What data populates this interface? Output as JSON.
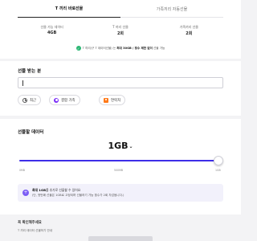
{
  "tabs": [
    {
      "label": "T 끼리 바로선물",
      "active": true
    },
    {
      "label": "가족끼리 자동선물",
      "active": false
    }
  ],
  "stats": [
    {
      "label": "선물 가능 데이터",
      "value": "4GB"
    },
    {
      "label": "T 끼리 선물",
      "value": "2회"
    },
    {
      "label": "가족끼리 선물",
      "value": "2회"
    }
  ],
  "info": {
    "icon": "check-icon",
    "prefix": "T 끼리(구 T 데이터선물) 는",
    "bold": "최대 30GB / 횟수 제한 없이",
    "suffix": "선물 가능"
  },
  "recipient": {
    "title": "선물 받는 분",
    "input_value": "",
    "chips": [
      {
        "label": "최근",
        "icon": "clock-icon"
      },
      {
        "label": "결합 가족",
        "icon": "family-icon"
      },
      {
        "label": "연락처",
        "icon": "contact-icon"
      }
    ]
  },
  "amount": {
    "title": "선물할 데이터",
    "value": "1GB",
    "chevron": "⌄",
    "slider_value_mb": 1000,
    "slider_max_mb": 1000,
    "ticks": [
      "0MB",
      "500MB",
      "1GB"
    ]
  },
  "notice": {
    "icon": "+",
    "line1_bold": "최대 1GB",
    "line1_rest": "를 추가로 선물할 수 있어요",
    "line2": "(단, 첫번째 선물은 1GB로 고정되며 선물하기 가능 횟수가 2회 차감됩니다.)"
  },
  "checklist": {
    "heading": "꼭 확인해주세요",
    "item": "T 끼리 데이터 선물하기 안내"
  },
  "colors": {
    "accent": "#3e2ee8",
    "info_green": "#2bb673",
    "notice_bg": "#f2f1fb"
  }
}
